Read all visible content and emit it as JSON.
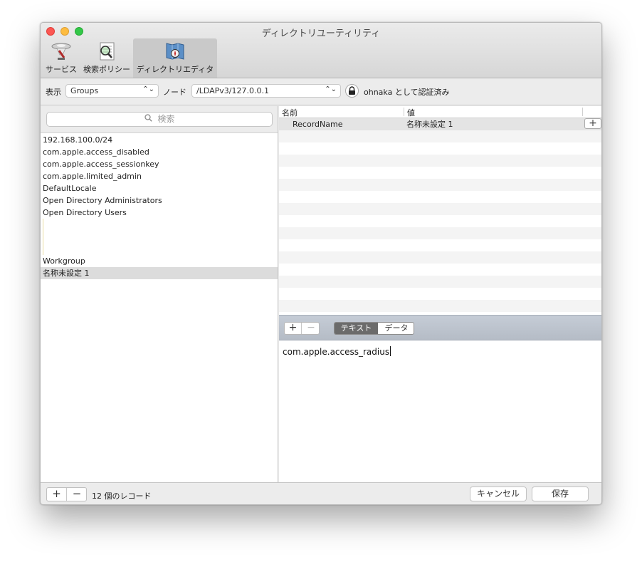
{
  "window": {
    "title": "ディレクトリユーティリティ"
  },
  "toolbar": {
    "items": [
      {
        "label": "サービス",
        "icon": "services-icon"
      },
      {
        "label": "検索ポリシー",
        "icon": "search-policy-icon"
      },
      {
        "label": "ディレクトリエディタ",
        "icon": "directory-editor-icon",
        "active": true
      }
    ]
  },
  "filter": {
    "view_label": "表示",
    "view_value": "Groups",
    "node_label": "ノード",
    "node_value": "/LDAPv3/127.0.0.1",
    "auth_text": "ohnaka として認証済み",
    "arrows": "⌃⌄"
  },
  "search": {
    "placeholder": "検索"
  },
  "records": [
    "192.168.100.0/24",
    "com.apple.access_disabled",
    "com.apple.access_sessionkey",
    "com.apple.limited_admin",
    "DefaultLocale",
    "Open Directory Administrators",
    "Open Directory Users",
    "",
    "",
    "",
    "Workgroup",
    "名称未設定 1"
  ],
  "selected_record_index": 11,
  "attributes": {
    "col_name": "名前",
    "col_value": "値",
    "rows": [
      {
        "name": "RecordName",
        "value": "名称未設定 1"
      }
    ],
    "add_symbol": "+"
  },
  "editor": {
    "plus": "+",
    "minus": "−",
    "tab_text": "テキスト",
    "tab_data": "データ",
    "value": "com.apple.access_radius"
  },
  "footer": {
    "plus": "+",
    "minus": "−",
    "record_count": "12 個のレコード",
    "cancel": "キャンセル",
    "save": "保存"
  },
  "colors": {
    "close": "#fc5753",
    "minimize": "#fdbc40",
    "zoom": "#33c748",
    "editor_bar": "#bcc3cd"
  }
}
